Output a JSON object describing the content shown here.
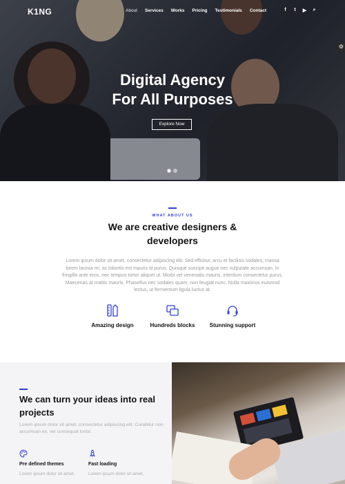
{
  "brand": {
    "logo": "K1NG"
  },
  "nav": {
    "items": [
      "About",
      "Services",
      "Works",
      "Pricing",
      "Testimonials",
      "Contact"
    ],
    "active_index": 0,
    "socials": [
      {
        "icon": "facebook-icon",
        "glyph": "f"
      },
      {
        "icon": "twitter-icon",
        "glyph": "t"
      },
      {
        "icon": "youtube-icon",
        "glyph": "▶"
      },
      {
        "icon": "search-icon",
        "glyph": "⌕"
      }
    ]
  },
  "hero": {
    "title_line1": "Digital Agency",
    "title_line2": "For All Purposes",
    "cta": "Explore Now",
    "slides": 2,
    "active_slide": 0,
    "settings_icon": "gear-icon"
  },
  "about": {
    "eyebrow": "WHAT ABOUT US",
    "title": "We are creative designers & developers",
    "text": "Lorem ipsum dolor sit amet, consectetur adipiscing elit. Sed efficitur, arcu et facilisis sodales, massa lorem lacinia mi, ac lobortis est mauris id purus. Quisque suscipit augue nec vulputate accumsan. In fringilla ante eros, nec tempus tortor aliquet ut. Morbi vel venenatis mauris, interdum consectetur purus. Maecenas at mattis mauris. Phasellus nec sodales quam, non feugiat nunc. Nulla maximus euismod lectus, ut fermentum ligula luctus at.",
    "features": [
      {
        "label": "Amazing design",
        "icon": "design-tools-icon"
      },
      {
        "label": "Hundreds blocks",
        "icon": "blocks-icon"
      },
      {
        "label": "Stunning support",
        "icon": "headset-icon"
      }
    ]
  },
  "ideas": {
    "title": "We can turn your ideas into real projects",
    "text": "Lorem ipsum dolor sit amet, consectetur adipiscing elit. Curabitur non accumsan ex, vel consequat tortor.",
    "items": [
      {
        "label": "Pre defined themes",
        "sub": "Lorem ipsum dolor sit amet,",
        "icon": "palette-icon"
      },
      {
        "label": "Fast loading",
        "sub": "Lorem ipsum dolor sit amet,",
        "icon": "rocket-icon"
      }
    ]
  },
  "colors": {
    "accent": "#2f3ed4",
    "text": "#111111",
    "muted": "#9a9a9a",
    "panel": "#f4f4f6"
  }
}
